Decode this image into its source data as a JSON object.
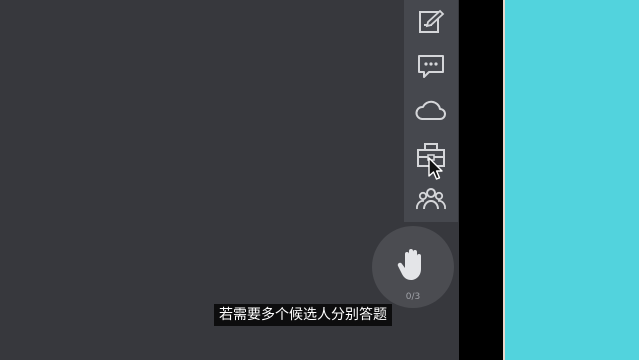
{
  "toolbar": {
    "items": [
      {
        "id": "notes",
        "icon": "edit-note-icon"
      },
      {
        "id": "chat",
        "icon": "chat-icon"
      },
      {
        "id": "cloud",
        "icon": "cloud-icon"
      },
      {
        "id": "toolbox",
        "icon": "toolbox-icon"
      },
      {
        "id": "members",
        "icon": "group-icon"
      }
    ]
  },
  "hand_raise": {
    "icon": "hand-icon",
    "count": "0/3"
  },
  "subtitle": {
    "text": "若需要多个候选人分别答题"
  },
  "colors": {
    "main_bg": "#37383d",
    "panel_bg": "#46484e",
    "accent_teal": "#52d3dd",
    "icon": "#d5d6d9"
  }
}
